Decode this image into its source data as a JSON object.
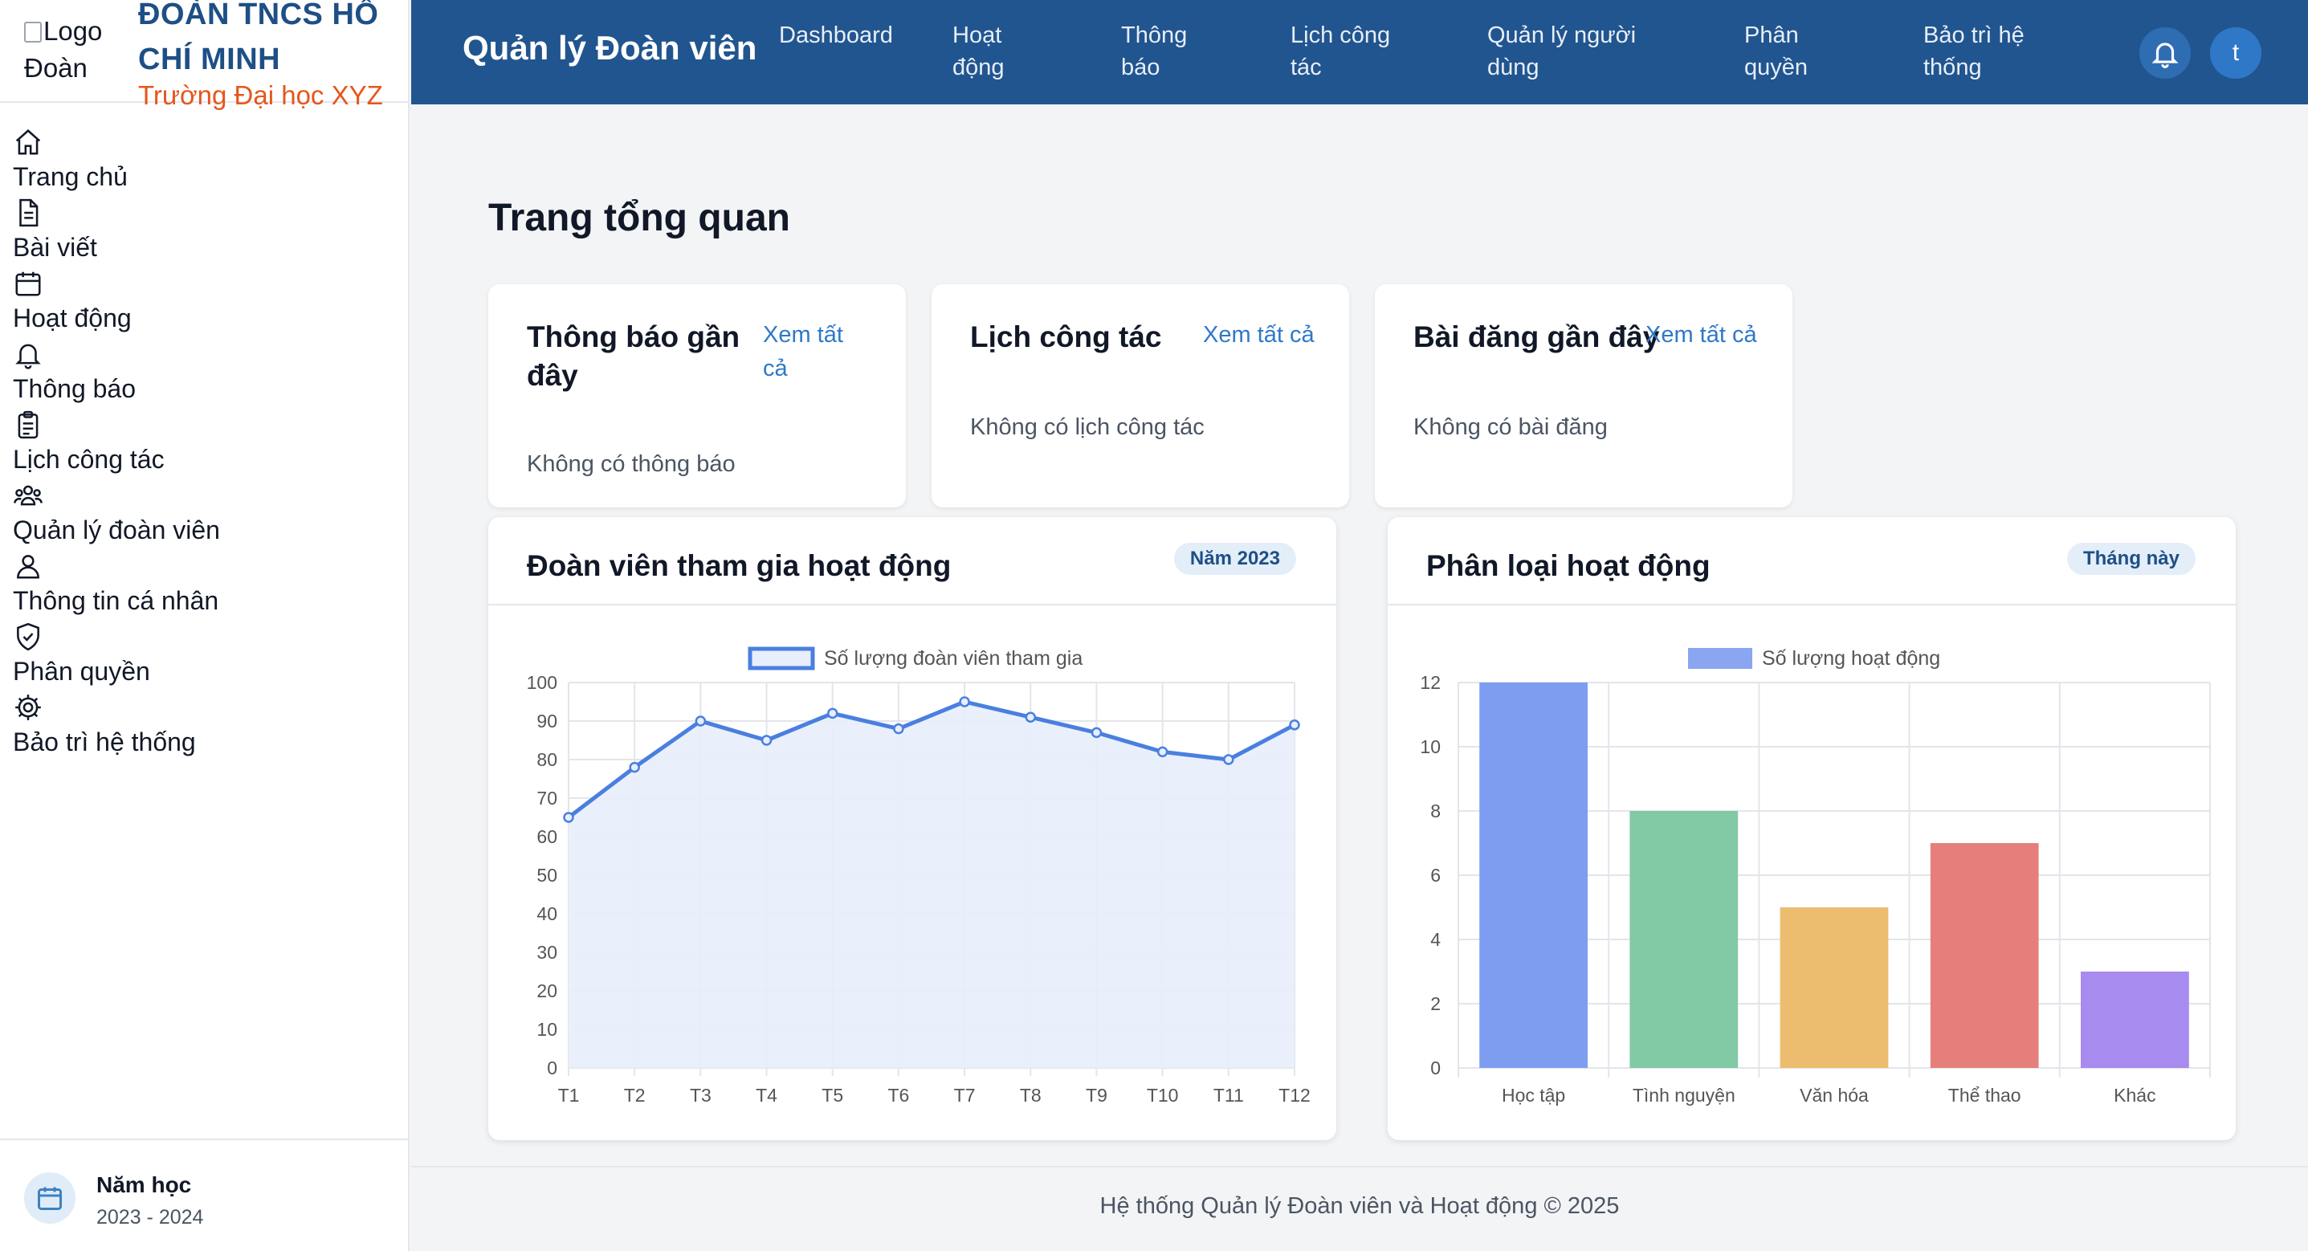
{
  "brand": {
    "logo_alt": "Logo Đoàn",
    "title": "ĐOÀN TNCS HỒ CHÍ MINH",
    "subtitle": "Trường Đại học XYZ"
  },
  "sidebar": {
    "items": [
      {
        "label": "Trang chủ",
        "icon": "home-icon"
      },
      {
        "label": "Bài viết",
        "icon": "document-icon"
      },
      {
        "label": "Hoạt động",
        "icon": "calendar-icon"
      },
      {
        "label": "Thông báo",
        "icon": "bell-icon"
      },
      {
        "label": "Lịch công tác",
        "icon": "clipboard-icon"
      },
      {
        "label": "Quản lý đoàn viên",
        "icon": "users-icon"
      },
      {
        "label": "Thông tin cá nhân",
        "icon": "user-icon"
      },
      {
        "label": "Phân quyền",
        "icon": "shield-check-icon"
      },
      {
        "label": "Bảo trì hệ thống",
        "icon": "gear-icon"
      }
    ],
    "year": {
      "label": "Năm học",
      "value": "2023 - 2024"
    }
  },
  "topnav": {
    "title": "Quản lý Đoàn viên",
    "links": [
      {
        "label": "Dashboard"
      },
      {
        "label": "Hoạt động"
      },
      {
        "label": "Thông báo"
      },
      {
        "label": "Lịch công tác"
      },
      {
        "label": "Quản lý người dùng"
      },
      {
        "label": "Phân quyền"
      },
      {
        "label": "Bảo trì hệ thống"
      }
    ],
    "avatar_initial": "t"
  },
  "main": {
    "page_title": "Trang tổng quan",
    "cards": [
      {
        "title": "Thông báo gần đây",
        "link": "Xem tất cả",
        "empty": "Không có thông báo"
      },
      {
        "title": "Lịch công tác",
        "link": "Xem tất cả",
        "empty": "Không có lịch công tác"
      },
      {
        "title": "Bài đăng gần đây",
        "link": "Xem tất cả",
        "empty": "Không có bài đăng"
      }
    ],
    "line_chart_card": {
      "title": "Đoàn viên tham gia hoạt động",
      "chip": "Năm 2023"
    },
    "bar_chart_card": {
      "title": "Phân loại hoạt động",
      "chip": "Tháng này"
    }
  },
  "chart_data": [
    {
      "type": "line",
      "categories": [
        "T1",
        "T2",
        "T3",
        "T4",
        "T5",
        "T6",
        "T7",
        "T8",
        "T9",
        "T10",
        "T11",
        "T12"
      ],
      "series": [
        {
          "name": "Số lượng đoàn viên tham gia",
          "values": [
            65,
            78,
            90,
            85,
            92,
            88,
            95,
            91,
            87,
            82,
            80,
            89
          ]
        }
      ],
      "ylim": [
        0,
        100
      ],
      "yticks": [
        0,
        10,
        20,
        30,
        40,
        50,
        60,
        70,
        80,
        90,
        100
      ],
      "grid": true,
      "legend": "top-center",
      "colors": {
        "line": "#4a7fe0",
        "fill": "#e8eefb"
      }
    },
    {
      "type": "bar",
      "categories": [
        "Học tập",
        "Tình nguyện",
        "Văn hóa",
        "Thể thao",
        "Khác"
      ],
      "series": [
        {
          "name": "Số lượng hoạt động",
          "values": [
            12,
            8,
            5,
            7,
            3
          ]
        }
      ],
      "ylim": [
        0,
        12
      ],
      "yticks": [
        0,
        2,
        4,
        6,
        8,
        10,
        12
      ],
      "grid": true,
      "legend": "top-center",
      "colors": [
        "#7d9ef0",
        "#82c9a5",
        "#ecbd6e",
        "#e67f7b",
        "#a78bef"
      ],
      "legend_color": "#8aa6f0"
    }
  ],
  "footer": {
    "text": "Hệ thống Quản lý Đoàn viên và Hoạt động © 2025"
  }
}
